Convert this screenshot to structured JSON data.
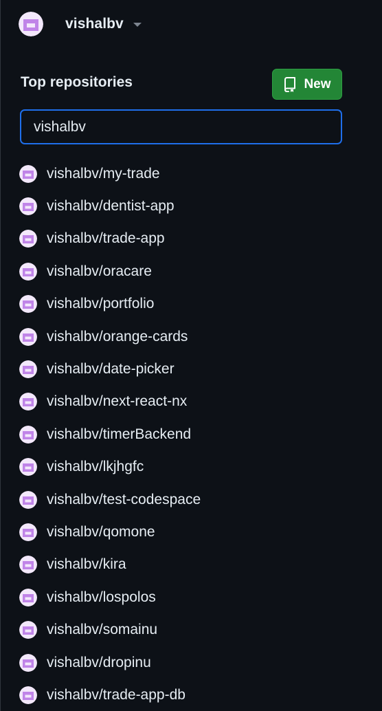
{
  "header": {
    "username": "vishalbv"
  },
  "top_repositories": {
    "title": "Top repositories",
    "new_button_label": "New",
    "search_value": "vishalbv",
    "repos": [
      "vishalbv/my-trade",
      "vishalbv/dentist-app",
      "vishalbv/trade-app",
      "vishalbv/oracare",
      "vishalbv/portfolio",
      "vishalbv/orange-cards",
      "vishalbv/date-picker",
      "vishalbv/next-react-nx",
      "vishalbv/timerBackend",
      "vishalbv/lkjhgfc",
      "vishalbv/test-codespace",
      "vishalbv/qomone",
      "vishalbv/kira",
      "vishalbv/lospolos",
      "vishalbv/somainu",
      "vishalbv/dropinu",
      "vishalbv/trade-app-db"
    ]
  },
  "colors": {
    "background": "#0d1117",
    "text": "#e6edf3",
    "new_button": "#238636",
    "focus_border": "#1f6feb",
    "avatar_accent": "#c084e8"
  },
  "icons": {
    "avatar": "identicon-avatar",
    "caret": "triangle-down-icon",
    "new_repo": "repo-icon"
  }
}
